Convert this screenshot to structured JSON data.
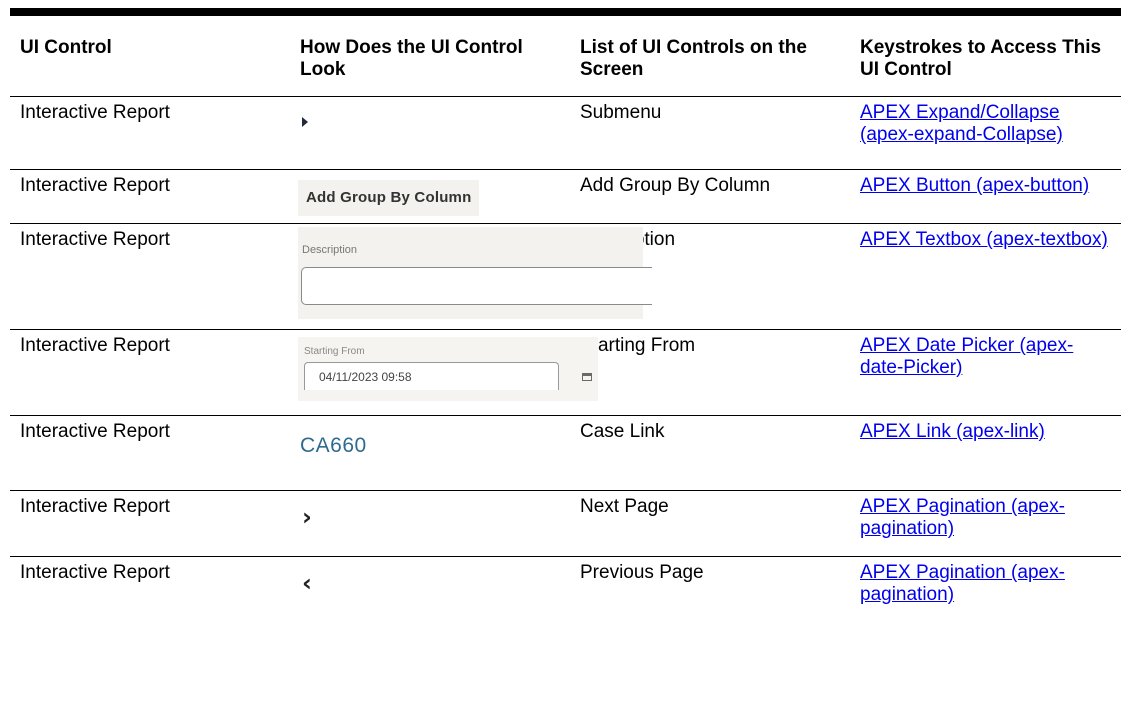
{
  "headers": {
    "col1": "UI Control",
    "col2": "How Does the UI Control Look",
    "col3": "List of UI Controls on the Screen",
    "col4": "Keystrokes to Access This UI Control"
  },
  "rows": [
    {
      "ui_control": "Interactive Report",
      "control_name": "Submenu",
      "keystroke_link": "APEX Expand/Collapse (apex-expand-Collapse)"
    },
    {
      "ui_control": "Interactive Report",
      "look_text": "Add Group By Column",
      "control_name": "Add Group By Column",
      "keystroke_link": "APEX Button (apex-button)"
    },
    {
      "ui_control": "Interactive Report",
      "look_label": "Description",
      "control_name": "Description",
      "keystroke_link": "APEX Textbox (apex-textbox)"
    },
    {
      "ui_control": "Interactive Report",
      "look_label": "Starting From",
      "look_value": "04/11/2023 09:58",
      "control_name": "Starting From",
      "keystroke_link": "APEX Date Picker (apex-date-Picker)"
    },
    {
      "ui_control": "Interactive Report",
      "look_text": "CA660",
      "control_name": "Case Link",
      "keystroke_link": "APEX Link (apex-link)"
    },
    {
      "ui_control": "Interactive Report",
      "look_glyph": "›",
      "control_name": "Next Page",
      "keystroke_link": "APEX Pagination (apex-pagination)"
    },
    {
      "ui_control": "Interactive Report",
      "look_glyph": "‹",
      "control_name": "Previous Page",
      "keystroke_link": "APEX Pagination (apex-pagination)"
    }
  ],
  "icons": {
    "submenu": "caret-right-icon",
    "calendar": "calendar-icon",
    "next": "chevron-right-icon",
    "previous": "chevron-left-icon"
  },
  "colors": {
    "link": "#0000ee",
    "case_link": "#2e6b8f",
    "rule": "#000000"
  }
}
